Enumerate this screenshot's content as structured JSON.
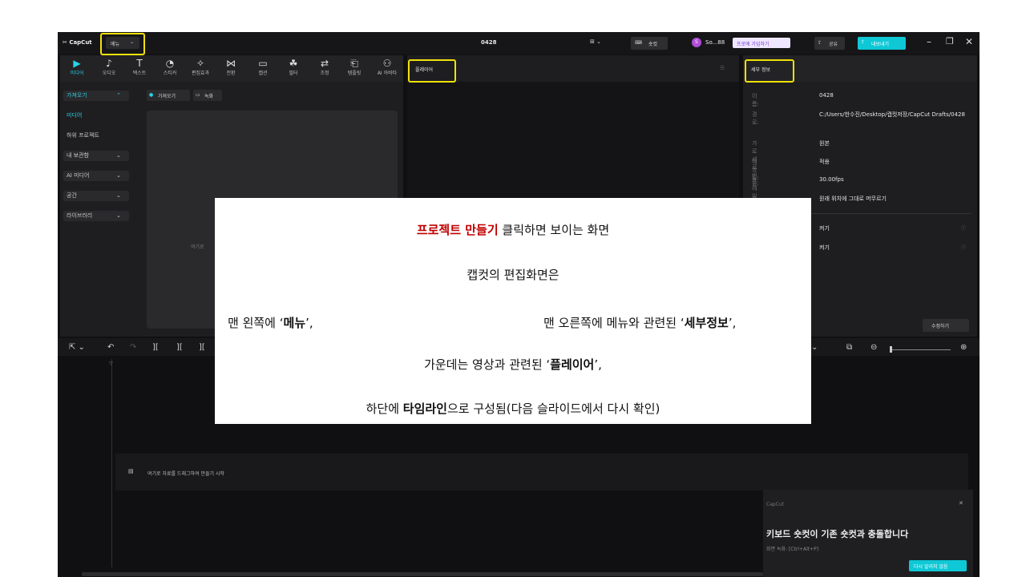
{
  "titlebar": {
    "logo": "CapCut",
    "menu_label": "메뉴",
    "project_title": "0428",
    "shortcut_label": "숏컷",
    "user_initial": "S",
    "user_name": "So...88",
    "signup_label": "프로에 가입하기",
    "share_label": "공유",
    "export_label": "내보내기"
  },
  "toolbar": {
    "tools": [
      {
        "icon": "▶",
        "label": "미디어"
      },
      {
        "icon": "♪",
        "label": "오디오"
      },
      {
        "icon": "T",
        "label": "텍스트"
      },
      {
        "icon": "◔",
        "label": "스티커"
      },
      {
        "icon": "✧",
        "label": "편집효과"
      },
      {
        "icon": "⋈",
        "label": "전환"
      },
      {
        "icon": "▭",
        "label": "캡션"
      },
      {
        "icon": "☘",
        "label": "필터"
      },
      {
        "icon": "⇄",
        "label": "조정"
      },
      {
        "icon": "⎗",
        "label": "템플릿"
      },
      {
        "icon": "⚇",
        "label": "AI 아바타"
      }
    ]
  },
  "left_nav": {
    "items": [
      "가져오기",
      "미디어",
      "하위 프로젝트",
      "내 보관함",
      "AI 미디어",
      "공간",
      "라이브러리"
    ]
  },
  "media": {
    "import_button": "가져오기",
    "record_button": "녹화",
    "drop_hint": "여기로"
  },
  "player": {
    "title": "플레이어"
  },
  "details": {
    "title": "세부 정보",
    "rows": [
      {
        "key": "이름:",
        "value": "0428"
      },
      {
        "key": "경로:",
        "value": "C:/Users/한수진/Desktop/캡컷저장/CapCut Drafts/0428"
      },
      {
        "key": "가로 세로 비율:",
        "value": "원본"
      },
      {
        "key": "해상도:",
        "value": "적용"
      },
      {
        "key": "프레임 속도:",
        "value": "30.00fps"
      },
      {
        "key": "가져온 미디어:",
        "value": "원래 위치에 그대로 머무르기"
      }
    ],
    "toggles": [
      "켜기",
      "켜기"
    ],
    "modify_button": "수정하기"
  },
  "timeline": {
    "drop_hint": "여기로 자료를 드래그하여 만들기 시작"
  },
  "toast": {
    "brand": "CapCut",
    "title": "키보드 숏컷이 기존 숏컷과 충돌합니다",
    "subtitle": "화면 녹화: [Ctrl+Alt+P]",
    "dismiss_button": "다시 알리지 않음"
  },
  "overlay": {
    "line1_bold": "프로젝트 만들기",
    "line1_rest": " 클릭하면 보이는 화면",
    "line2": "캡컷의 편집화면은",
    "line3a_pre": "맨 왼쪽에 ‘",
    "line3a_bold": "메뉴",
    "line3a_post": "’,",
    "line3b_pre": "맨 오른쪽에 메뉴와 관련된 ‘",
    "line3b_bold": "세부정보",
    "line3b_post": "’,",
    "line4_pre": "가운데는 영상과 관련된 ‘",
    "line4_bold": "플레이어",
    "line4_post": "’,",
    "line5_pre": "하단에 ",
    "line5_bold": "타임라인",
    "line5_post": "으로 구성됨(다음 슬라이드에서 다시 확인)"
  }
}
